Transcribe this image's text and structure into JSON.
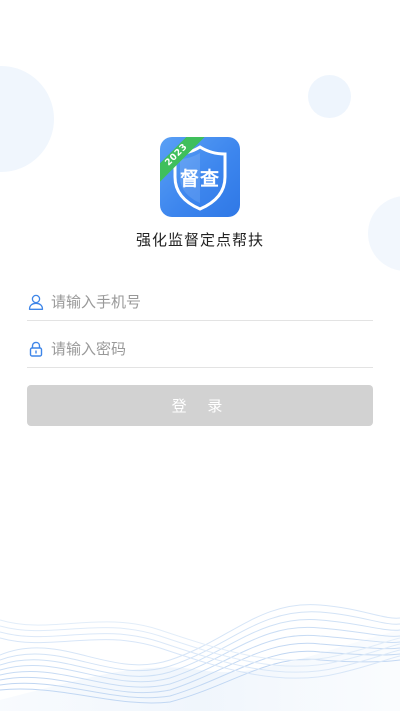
{
  "app": {
    "logo_text": "督查",
    "logo_badge": "2023",
    "name": "强化监督定点帮扶"
  },
  "login_form": {
    "phone_placeholder": "请输入手机号",
    "password_placeholder": "请输入密码",
    "login_label": "登 录"
  },
  "colors": {
    "logo_blue": "#3d86ee",
    "badge_green": "#3fbf5c",
    "icon_blue": "#3f86e8",
    "button_disabled": "#d2d2d2"
  }
}
